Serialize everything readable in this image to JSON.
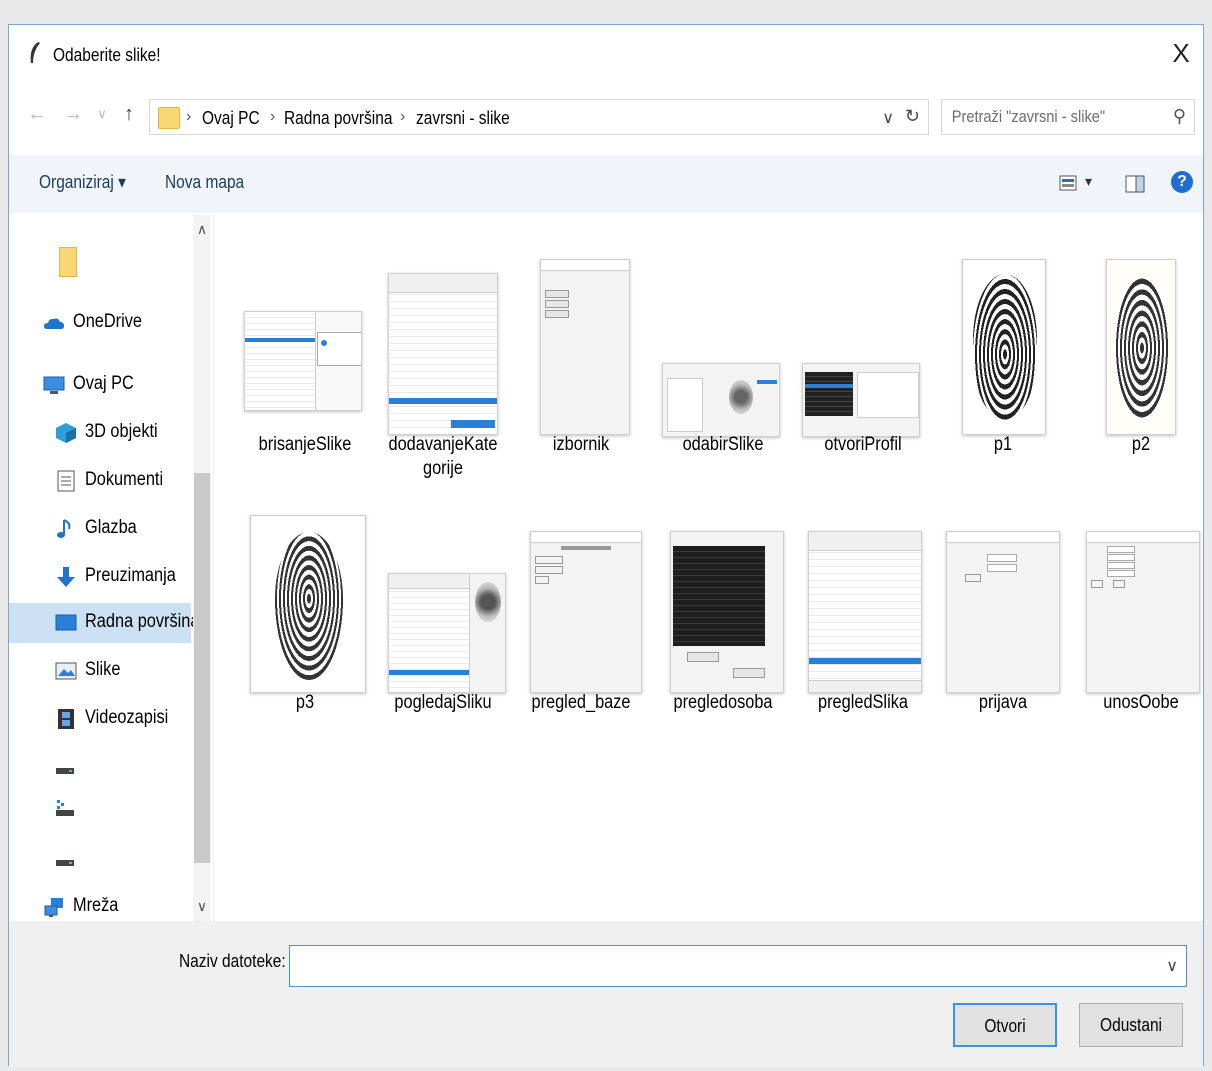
{
  "window": {
    "title": "Odaberite slike!",
    "close": "X"
  },
  "nav": {
    "back": "←",
    "forward": "→",
    "recent": "∨",
    "up": "↑"
  },
  "address": {
    "crumbs": [
      "Ovaj PC",
      "Radna površina",
      "zavrsni - slike"
    ],
    "separator": "›",
    "dropdown": "∨",
    "refresh": "↻"
  },
  "search": {
    "placeholder": "Pretraži \"zavrsni - slike\"",
    "icon": "⚲"
  },
  "toolbar": {
    "organize": "Organiziraj ▾",
    "new_folder": "Nova mapa",
    "help": "?",
    "view_dd": "▾"
  },
  "sidebar": {
    "items": [
      {
        "label": "",
        "icon": "folder-icon"
      },
      {
        "label": "OneDrive",
        "icon": "cloud-icon"
      },
      {
        "label": "Ovaj PC",
        "icon": "computer-icon"
      },
      {
        "label": "3D objekti",
        "icon": "cube-icon"
      },
      {
        "label": "Dokumenti",
        "icon": "document-icon"
      },
      {
        "label": "Glazba",
        "icon": "music-note-icon"
      },
      {
        "label": "Preuzimanja",
        "icon": "download-icon"
      },
      {
        "label": "Radna površina",
        "icon": "desktop-icon"
      },
      {
        "label": "Slike",
        "icon": "pictures-icon"
      },
      {
        "label": "Videozapisi",
        "icon": "video-icon"
      },
      {
        "label": "",
        "icon": "drive-icon"
      },
      {
        "label": "",
        "icon": "network-drive-icon"
      },
      {
        "label": "",
        "icon": "drive-icon"
      },
      {
        "label": "Mreža",
        "icon": "network-icon"
      }
    ],
    "scroll_up": "∧",
    "scroll_down": "∨"
  },
  "files": [
    {
      "name": "brisanjeSlike",
      "kind": "screenshot"
    },
    {
      "name": "dodavanjeKategorije",
      "kind": "screenshot"
    },
    {
      "name": "izbornik",
      "kind": "screenshot"
    },
    {
      "name": "odabirSlike",
      "kind": "screenshot"
    },
    {
      "name": "otvoriProfil",
      "kind": "screenshot"
    },
    {
      "name": "p1",
      "kind": "fingerprint"
    },
    {
      "name": "p2",
      "kind": "fingerprint"
    },
    {
      "name": "p3",
      "kind": "fingerprint"
    },
    {
      "name": "pogledajSliku",
      "kind": "screenshot"
    },
    {
      "name": "pregled_baze",
      "kind": "screenshot"
    },
    {
      "name": "pregledosoba",
      "kind": "screenshot"
    },
    {
      "name": "pregledSlika",
      "kind": "screenshot"
    },
    {
      "name": "prijava",
      "kind": "screenshot"
    },
    {
      "name": "unosOobe",
      "kind": "screenshot"
    }
  ],
  "bottom": {
    "filename_label": "Naziv datoteke:",
    "filename_value": "",
    "open": "Otvori",
    "cancel": "Odustani",
    "dropdown": "∨"
  }
}
